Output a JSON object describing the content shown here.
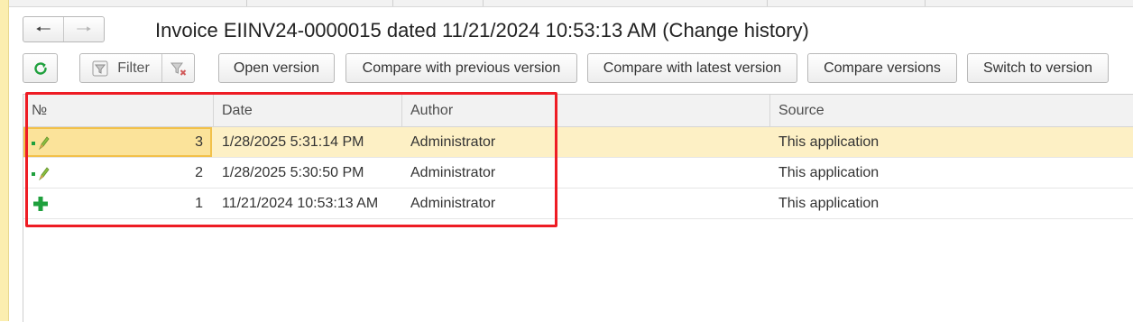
{
  "window": {
    "title": "Invoice EIINV24-0000015 dated 11/21/2024 10:53:13 AM (Change history)"
  },
  "navigation": {
    "back_icon": "arrow-left-icon",
    "forward_icon": "arrow-right-icon"
  },
  "toolbar": {
    "refresh_icon": "refresh-icon",
    "filter_label": "Filter",
    "clear_filter_icon": "clear-filter-icon",
    "buttons": [
      "Open version",
      "Compare with previous version",
      "Compare with latest version",
      "Compare versions",
      "Switch to version"
    ]
  },
  "table": {
    "columns": [
      "№",
      "Date",
      "Author",
      "Source"
    ],
    "rows": [
      {
        "no": "3",
        "date": "1/28/2025 5:31:14 PM",
        "author": "Administrator",
        "source": "This application",
        "icon": "edit-icon",
        "selected": true
      },
      {
        "no": "2",
        "date": "1/28/2025 5:30:50 PM",
        "author": "Administrator",
        "source": "This application",
        "icon": "edit-icon",
        "selected": false
      },
      {
        "no": "1",
        "date": "11/21/2024 10:53:13 AM",
        "author": "Administrator",
        "source": "This application",
        "icon": "add-icon",
        "selected": false
      }
    ]
  },
  "colors": {
    "accent_green": "#1fa03d",
    "selection_row": "#fdf0c5",
    "highlight_border": "#ee1c24"
  }
}
